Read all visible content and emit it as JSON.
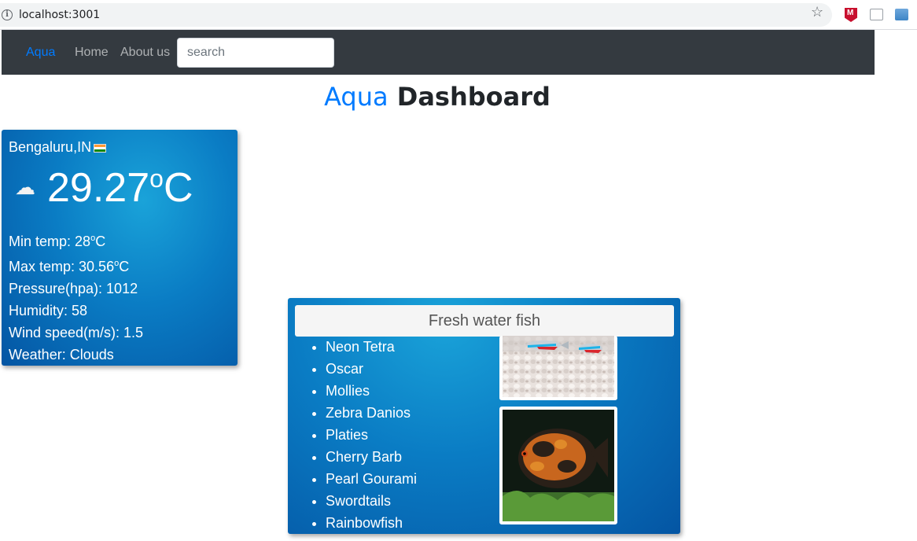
{
  "browser": {
    "url": "localhost:3001"
  },
  "navbar": {
    "brand": "Aqua",
    "links": [
      "Home",
      "About us"
    ],
    "search_placeholder": "search"
  },
  "page": {
    "title_accent": "Aqua",
    "title_rest": "Dashboard"
  },
  "weather": {
    "city": "Bengaluru,IN",
    "icon": "cloud-icon",
    "temperature": "29.27",
    "temp_unit_o": "o",
    "temp_unit_c": "C",
    "min_temp_label": "Min temp: ",
    "min_temp_value": "28",
    "max_temp_label": "Max temp: ",
    "max_temp_value": "30.56",
    "pressure": "Pressure(hpa): 1012",
    "humidity": "Humidity: 58",
    "wind": "Wind speed(m/s): 1.5",
    "weather": "Weather: Clouds"
  },
  "fish": {
    "title": "Fresh water fish",
    "items": [
      "Neon Tetra",
      "Oscar",
      "Mollies",
      "Zebra Danios",
      "Platies",
      "Cherry Barb",
      "Pearl Gourami",
      "Swordtails",
      "Rainbowfish"
    ]
  },
  "colors": {
    "accent": "#007bff",
    "navbar_bg": "#343a40",
    "card_blue": "#0a7cc4"
  }
}
